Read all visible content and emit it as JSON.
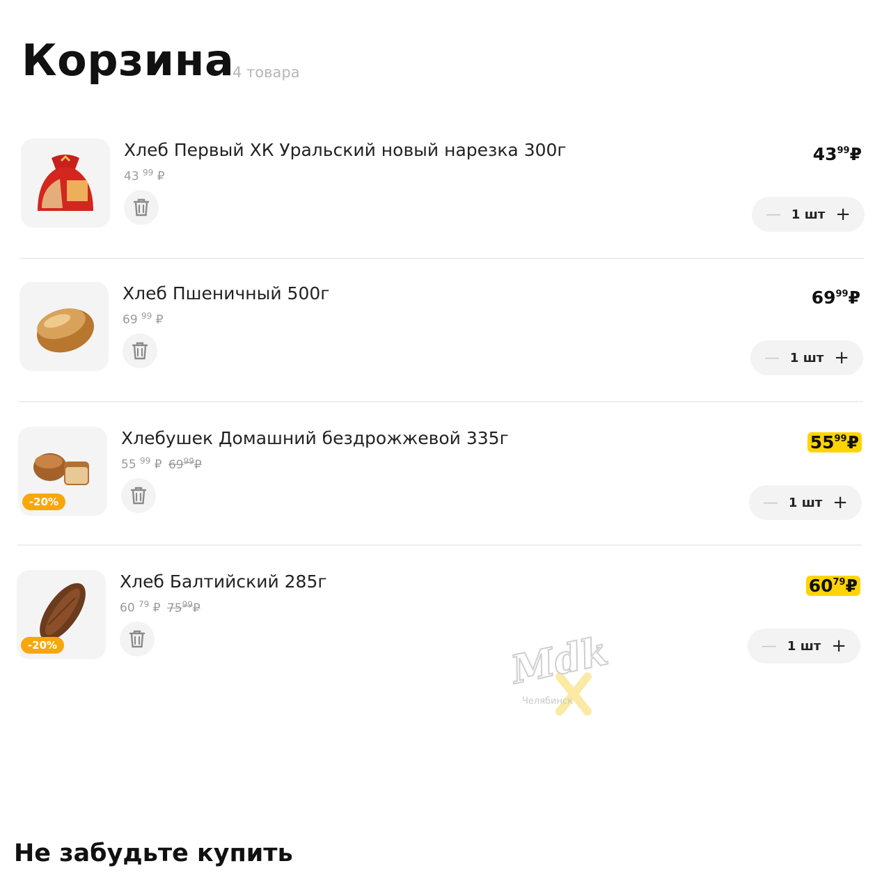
{
  "header": {
    "title": "Корзина",
    "count": "4 товара"
  },
  "items": [
    {
      "name": "Хлеб Первый ХК Уральский новый нарезка 300г",
      "unit_price_int": "43",
      "unit_price_dec": "99",
      "currency": "₽",
      "old_price_int": "",
      "old_price_dec": "",
      "price_int": "43",
      "price_dec": "99",
      "qty": "1 шт",
      "discount": "",
      "on_sale": false,
      "image": "packaged-bread"
    },
    {
      "name": "Хлеб Пшеничный 500г",
      "unit_price_int": "69",
      "unit_price_dec": "99",
      "currency": "₽",
      "old_price_int": "",
      "old_price_dec": "",
      "price_int": "69",
      "price_dec": "99",
      "qty": "1 шт",
      "discount": "",
      "on_sale": false,
      "image": "wheat-loaf"
    },
    {
      "name": "Хлебушек Домашний бездрожжевой 335г",
      "unit_price_int": "55",
      "unit_price_dec": "99",
      "currency": "₽",
      "old_price_int": "69",
      "old_price_dec": "99",
      "price_int": "55",
      "price_dec": "99",
      "qty": "1 шт",
      "discount": "-20%",
      "on_sale": true,
      "image": "homemade-loaf"
    },
    {
      "name": "Хлеб Балтийский 285г",
      "unit_price_int": "60",
      "unit_price_dec": "79",
      "currency": "₽",
      "old_price_int": "75",
      "old_price_dec": "99",
      "price_int": "60",
      "price_dec": "79",
      "qty": "1 шт",
      "discount": "-20%",
      "on_sale": true,
      "image": "baltic-rye-loaf"
    }
  ],
  "stepper": {
    "minus": "—",
    "plus": "+"
  },
  "recommendations": {
    "title": "Не забудьте купить"
  },
  "watermark": {
    "logo": "Mdk",
    "city": "Челябинск"
  },
  "colors": {
    "sale_highlight": "#ffd400",
    "discount_badge": "#f7a70a",
    "tile_bg": "#f4f4f4"
  }
}
